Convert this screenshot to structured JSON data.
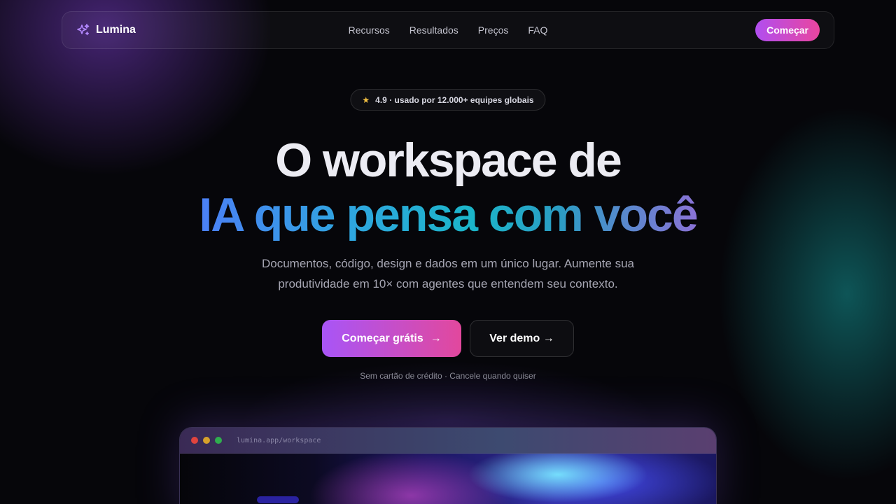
{
  "nav": {
    "brand": "Lumina",
    "links": [
      "Recursos",
      "Resultados",
      "Preços",
      "FAQ"
    ],
    "cta": "Começar"
  },
  "badge": {
    "icon": "star-icon",
    "text": "4.9 · usado por 12.000+ equipes globais"
  },
  "hero": {
    "title_line1": "O workspace de",
    "title_line2": "IA que pensa com você",
    "subtitle": "Documentos, código, design e dados em um único lugar. Aumente sua produtividade em 10× com agentes que entendem seu contexto.",
    "primary_cta": "Começar grátis",
    "primary_cta_arrow": "→",
    "secondary_cta": "Ver demo →",
    "note": "Sem cartão de crédito · Cancele quando quiser"
  },
  "preview": {
    "url": "lumina.app/workspace"
  },
  "colors": {
    "background": "#06060a",
    "accent_purple": "#a855f7",
    "accent_pink": "#e2489d",
    "star": "#f5c243"
  }
}
